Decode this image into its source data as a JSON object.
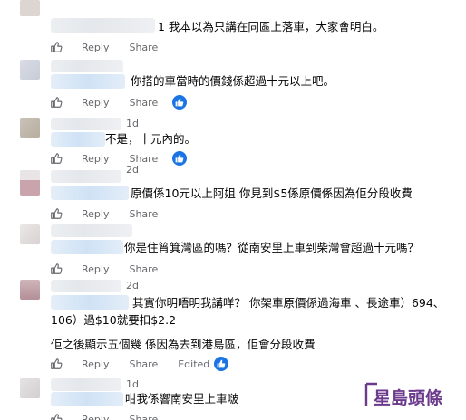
{
  "actions": {
    "reply": "Reply",
    "share": "Share",
    "edited": "Edited"
  },
  "comments": [
    {
      "age": "",
      "lines": [
        "1 我本以為只講在同區上落車，大家會明白。"
      ]
    },
    {
      "age": "",
      "lines": [
        "你搭的車當時的價錢係超過十元以上吧。"
      ]
    },
    {
      "age": "1d",
      "lines": [
        "不是，十元內的。"
      ]
    },
    {
      "age": "2d",
      "lines": [
        "原價係10元以上阿姐 你見到$5係原價係因為佢分段收費"
      ]
    },
    {
      "age": "",
      "lines": [
        "你是住筲箕灣區的嗎？從南安里上車到柴灣會超過十元嗎？"
      ]
    },
    {
      "age": "2d",
      "lines": [
        "其實你明唔明我講咩？ 你架車原價係過海車 、長途車）694、",
        "106）過$10就要扣$2.2",
        "佢之後顯示五個幾 係因為去到港島區，佢會分段收費"
      ]
    },
    {
      "age": "1d",
      "lines": [
        "咁我係響南安里上車啵"
      ]
    }
  ],
  "watermark": {
    "text": "星島頭條"
  },
  "colors": {
    "reaction_blue": "#1b74e4",
    "meta_gray": "#65676b",
    "watermark_purple": "#6b3a8c"
  }
}
